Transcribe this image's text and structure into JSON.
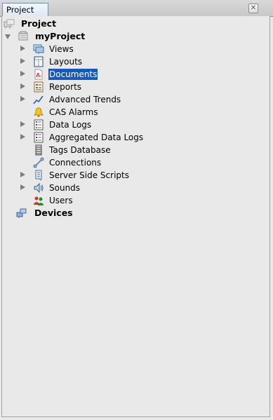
{
  "tab": {
    "label": "Project"
  },
  "tree": {
    "root_label": "Project",
    "project": {
      "label": "myProject",
      "children": [
        {
          "label": "Views",
          "expandable": true,
          "icon": "views-icon"
        },
        {
          "label": "Layouts",
          "expandable": true,
          "icon": "layouts-icon"
        },
        {
          "label": "Documents",
          "expandable": true,
          "icon": "pdf-document-icon",
          "selected": true
        },
        {
          "label": "Reports",
          "expandable": true,
          "icon": "reports-icon"
        },
        {
          "label": "Advanced Trends",
          "expandable": true,
          "icon": "trend-line-icon"
        },
        {
          "label": "CAS Alarms",
          "expandable": false,
          "icon": "alarm-bell-icon"
        },
        {
          "label": "Data Logs",
          "expandable": true,
          "icon": "data-log-icon"
        },
        {
          "label": "Aggregated Data Logs",
          "expandable": true,
          "icon": "aggregated-data-log-icon"
        },
        {
          "label": "Tags Database",
          "expandable": false,
          "icon": "database-icon"
        },
        {
          "label": "Connections",
          "expandable": false,
          "icon": "connection-link-icon"
        },
        {
          "label": "Server Side Scripts",
          "expandable": true,
          "icon": "script-icon"
        },
        {
          "label": "Sounds",
          "expandable": true,
          "icon": "speaker-icon"
        },
        {
          "label": "Users",
          "expandable": false,
          "icon": "users-icon"
        }
      ]
    },
    "devices_label": "Devices"
  },
  "colors": {
    "selection": "#1b57b8",
    "tab_border": "#6f8fb3"
  }
}
